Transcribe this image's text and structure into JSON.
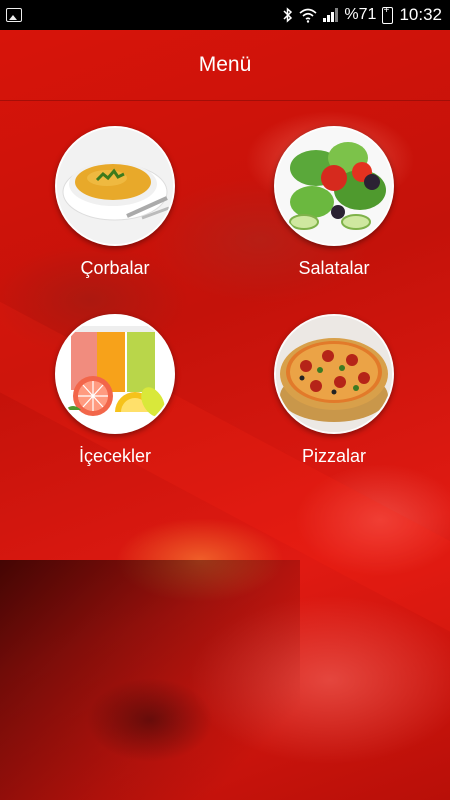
{
  "status_bar": {
    "battery_percent": "%71",
    "time": "10:32",
    "icons": [
      "image-icon",
      "bluetooth-icon",
      "wifi-icon",
      "signal-icon",
      "battery-icon"
    ]
  },
  "header": {
    "title": "Menü"
  },
  "menu": {
    "items": [
      {
        "label": "Çorbalar",
        "icon": "soup-icon"
      },
      {
        "label": "Salatalar",
        "icon": "salad-icon"
      },
      {
        "label": "İçecekler",
        "icon": "drinks-icon"
      },
      {
        "label": "Pizzalar",
        "icon": "pizza-icon"
      }
    ]
  },
  "colors": {
    "accent": "#d9140a",
    "statusbar": "#000000",
    "text": "#ffffff"
  }
}
